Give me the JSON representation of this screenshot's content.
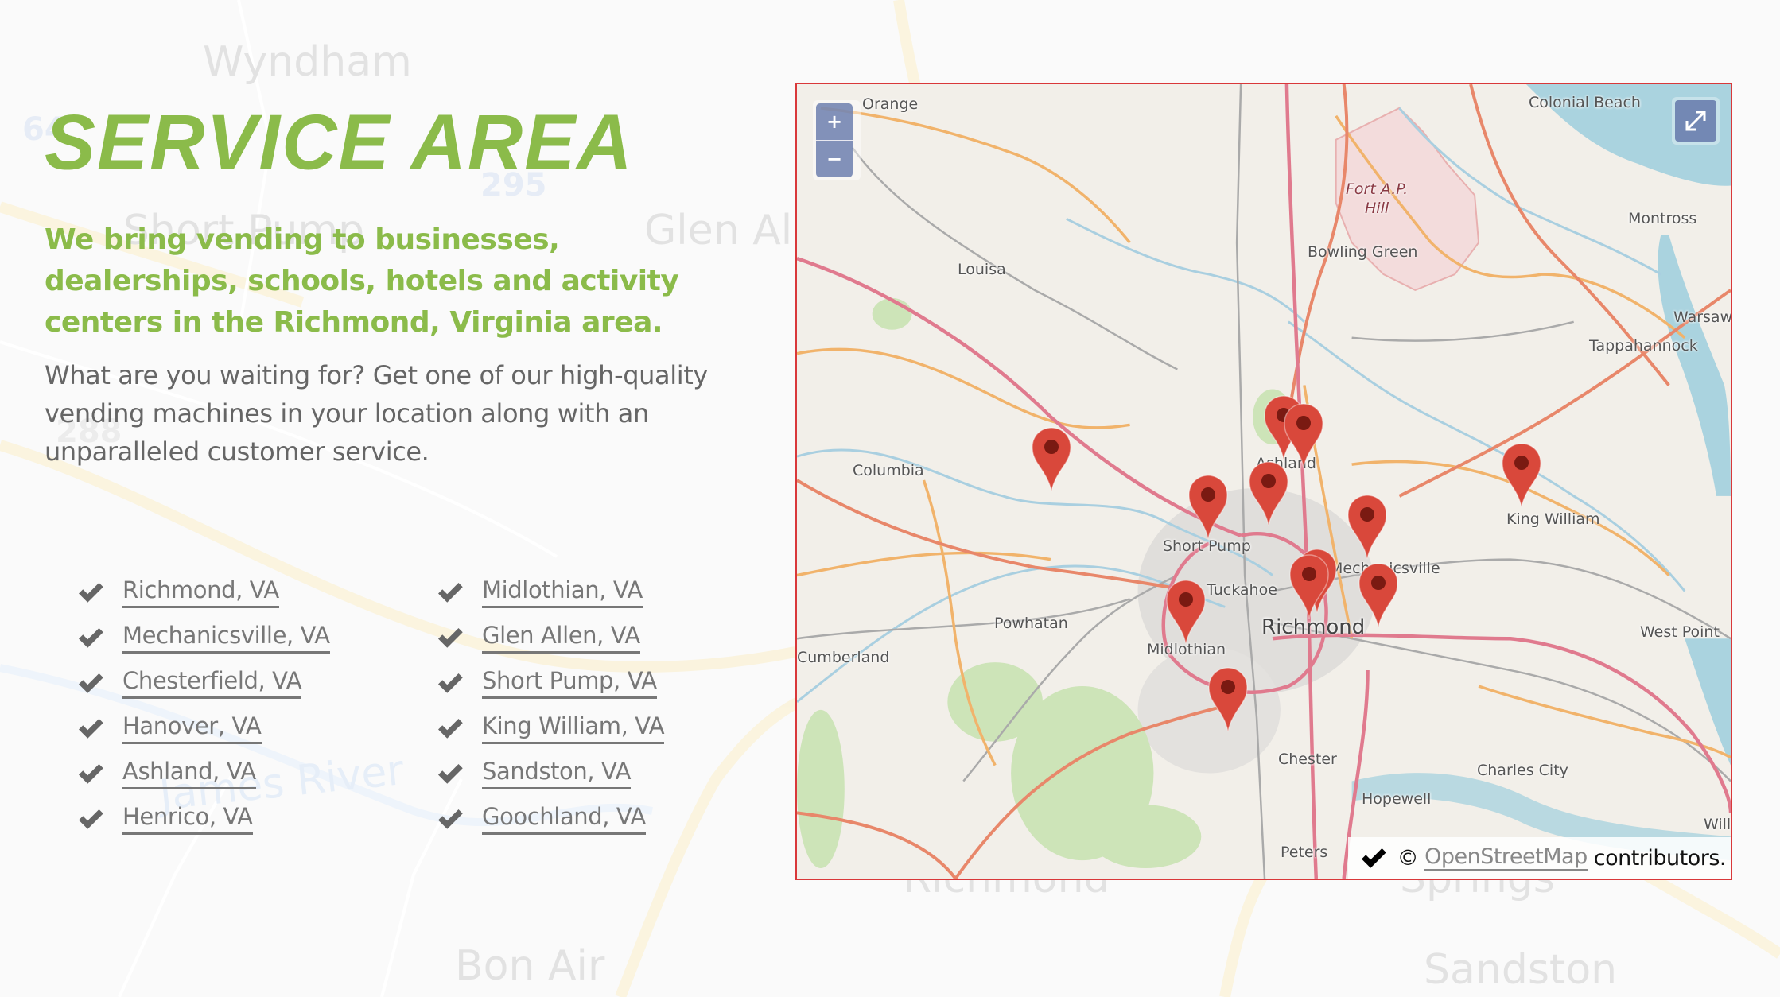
{
  "section": {
    "title": "SERVICE AREA",
    "lead": "We bring vending to businesses, dealerships, schools, hotels and activity centers in the Richmond, Virginia area.",
    "body": "What are you waiting for? Get one of our high-quality vending machines in your location along with an unparalleled customer service."
  },
  "cities": {
    "column1": [
      "Richmond, VA",
      "Mechanicsville, VA",
      "Chesterfield, VA",
      "Hanover, VA",
      "Ashland, VA",
      "Henrico, VA"
    ],
    "column2": [
      "Midlothian, VA",
      "Glen Allen, VA",
      "Short Pump, VA",
      "King William, VA",
      "Sandston, VA",
      "Goochland, VA"
    ]
  },
  "background_map": {
    "labels": [
      "Wyndham",
      "Short Pump",
      "Glen Allen",
      "James River",
      "Richmond",
      "Springs",
      "Bon Air",
      "Sandston"
    ],
    "shields": [
      "64",
      "295",
      "288"
    ]
  },
  "map": {
    "zoom_in_label": "+",
    "zoom_out_label": "−",
    "fullscreen_icon": "expand-arrows-icon",
    "place_labels": {
      "orange": "Orange",
      "colonial_beach": "Colonial Beach",
      "fort_ap_hill_1": "Fort A.P.",
      "fort_ap_hill_2": "Hill",
      "montross": "Montross",
      "bowling_green": "Bowling Green",
      "louisa": "Louisa",
      "warsaw": "Warsaw",
      "tappahannock": "Tappahannock",
      "ashland": "Ashland",
      "columbia": "Columbia",
      "king_william": "King William",
      "short_pump": "Short Pump",
      "mechanicsville": "Mechanicsville",
      "tuckahoe": "Tuckahoe",
      "richmond": "Richmond",
      "powhatan": "Powhatan",
      "west_point": "West Point",
      "cumberland": "Cumberland",
      "midlothian": "Midlothian",
      "chester": "Chester",
      "charles_city": "Charles City",
      "hopewell": "Hopewell",
      "williamsburg": "William",
      "petersburg": "Peters"
    },
    "marker_count": 12,
    "marker_color": "#d9483b",
    "attribution": {
      "prefix": "©",
      "link": "OpenStreetMap",
      "suffix": "contributors."
    }
  },
  "colors": {
    "accent_green": "#8bbb4a",
    "body_gray": "#666666",
    "map_border": "#d9383a"
  }
}
